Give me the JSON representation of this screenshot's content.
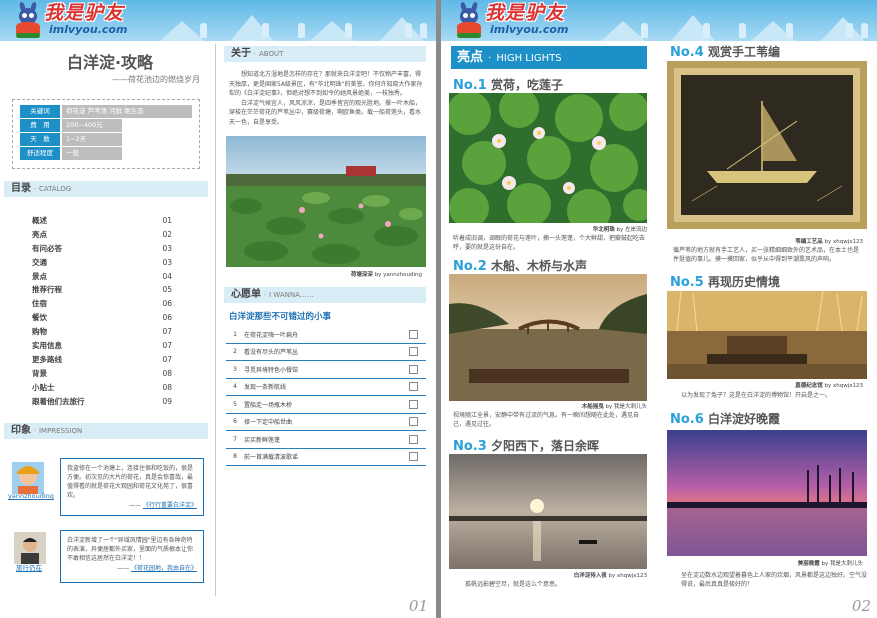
{
  "brand": {
    "name": "我是驴友",
    "url": "imlvyou.com"
  },
  "page1": {
    "title": "白洋淀·攻略",
    "subtitle": "——荷花池边的燃烧岁月",
    "info": [
      {
        "key": "关键词",
        "value": "荷花淀 芦苇荡 河鲜 眼生态"
      },
      {
        "key": "费　用",
        "value": "200~400元"
      },
      {
        "key": "天　数",
        "value": "1~2天"
      },
      {
        "key": "舒适程度",
        "value": "一般"
      }
    ],
    "catalog": {
      "title": "目录",
      "en": "CATALOG",
      "items": [
        {
          "label": "概述",
          "page": "01"
        },
        {
          "label": "亮点",
          "page": "02"
        },
        {
          "label": "有问必答",
          "page": "03"
        },
        {
          "label": "交通",
          "page": "03"
        },
        {
          "label": "景点",
          "page": "04"
        },
        {
          "label": "推荐行程",
          "page": "05"
        },
        {
          "label": "住宿",
          "page": "06"
        },
        {
          "label": "餐饮",
          "page": "06"
        },
        {
          "label": "购物",
          "page": "07"
        },
        {
          "label": "实用信息",
          "page": "07"
        },
        {
          "label": "更多路线",
          "page": "07"
        },
        {
          "label": "背景",
          "page": "08"
        },
        {
          "label": "小贴士",
          "page": "08"
        },
        {
          "label": "跟着他们去旅行",
          "page": "09"
        }
      ]
    },
    "impression": {
      "title": "印象",
      "en": "IMPRESSION",
      "items": [
        {
          "user": "yannzhouding",
          "text": "我盗修在一个池塘上，连接住宿和吃饭的，很是方便。初次见的大片的荷花，真是会惊喜哉，最值得看的就是荷花大观园和荷花文化苑了，很喜欢。",
          "link": "《行行重要白洋淀》"
        },
        {
          "user": "旅行仍在",
          "text": "白洋淀新增了一个\"异域风情园\"里边有各种奇特的表演，异便居都外买家，里面的气质根本让你不敢相信这居然在白洋淀！！",
          "link": "《荷花园地，我由自在》"
        }
      ]
    },
    "about": {
      "title": "关于",
      "en": "ABOUT",
      "p1": "想知道北方湿地是怎样的存在？那就来白洋淀吧！不仅物产丰富，得天独厚，更是国家5A级景区，有\"华北明珠\"的美誉。你何许知晓大作家孙犁的《白洋淀纪事》，但绝对想不到如今的她风景绝美，一枝独秀。",
      "p2": "白洋淀气候宜人，风风凉凉，是四季皆宜的观光胜地。撑一叶木船，穿梭在茫茫荷花的芦苇丛中，赛级荷塘，啊欧鱼类。载一船荷莲头，看水天一色，自是享受。",
      "photo_caption": "荷塘深深",
      "photo_by": "by yannzhouding"
    },
    "wish": {
      "title": "心愿单",
      "en": "I WANNA……",
      "heading": "白洋淀那些不可错过的小事",
      "items": [
        {
          "n": "1",
          "t": "在荷花淀嗨一叶扁舟"
        },
        {
          "n": "2",
          "t": "看没有尽头的芦苇丛"
        },
        {
          "n": "3",
          "t": "寻觅异境特色小餐馆"
        },
        {
          "n": "4",
          "t": "发现一条新航线"
        },
        {
          "n": "5",
          "t": "置船走一场瓶木桥"
        },
        {
          "n": "6",
          "t": "择一下定中船世曲"
        },
        {
          "n": "7",
          "t": "买买新鲜莲蓬"
        },
        {
          "n": "8",
          "t": "前一首满载清波歌谣"
        }
      ]
    },
    "page_num": "01"
  },
  "page2": {
    "highlights": {
      "title": "亮点",
      "en": "HIGH LIGHTS"
    },
    "items": [
      {
        "no": "No.1",
        "title": "赏荷，吃莲子",
        "caption": "华北明珠",
        "by": "by 左岸流边",
        "desc": "听着成旧调，调眼的荷花与莲叶，摘一头莲蓬，个大鲜甜，把瓣鼓起吃去呼，要的就是这份自在。"
      },
      {
        "no": "No.2",
        "title": "木船、木桥与水声",
        "caption": "木船摇曳",
        "by": "by 我是大刺儿头",
        "desc": "视境随江全景，安静中带有过流的气息。有一瞬间想随在此处，遇见自己，遇见过往。"
      },
      {
        "no": "No.3",
        "title": "夕阳西下，落日余晖",
        "caption": "白洋淀待入夜",
        "by": "by xhqwjx123",
        "desc": "孤帆远影碧空尽，就是这么个意思。"
      },
      {
        "no": "No.4",
        "title": "观赏手工苇编",
        "caption": "苇编工艺品",
        "by": "by xhqwjx123",
        "desc": "循芦苇的地方就有手工艺人，买一张精细细致外的艺术品，在本土也是件挺值的事儿。摸一摸回家，似乎从中得到平潮熏风的声响。"
      },
      {
        "no": "No.5",
        "title": "再现历史情境",
        "caption": "嘉德纪念馆",
        "by": "by xhqwjx123",
        "desc": "以为发现了兔子？这是在白洋淀的博物馆！开启是之一。"
      },
      {
        "no": "No.6",
        "title": "白洋淀好晚霞",
        "caption": "美丽晚霞",
        "by": "by 我是大刺儿头",
        "desc": "坐在淀边数水边观望着暮色上人家的炊烟，风景都是这边独好。空气没得说，最后真真是极好的！"
      }
    ],
    "page_num": "02"
  }
}
